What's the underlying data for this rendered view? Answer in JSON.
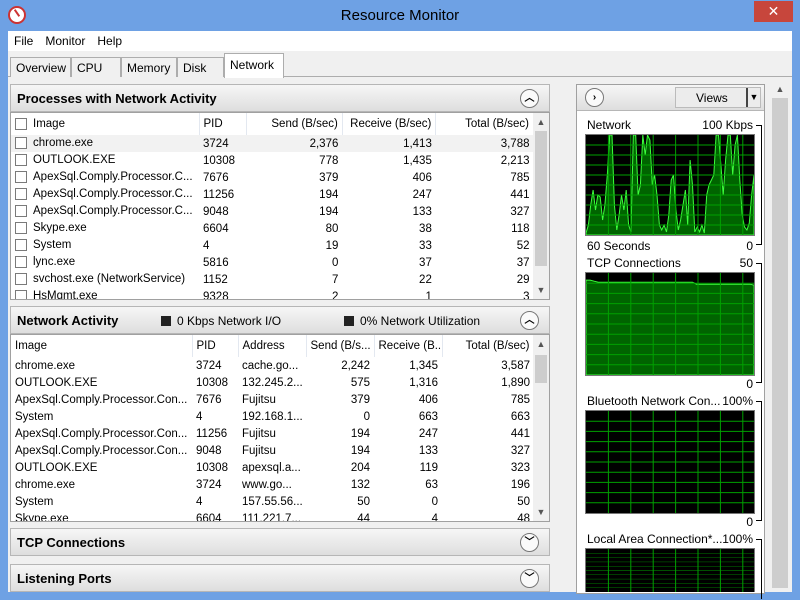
{
  "window": {
    "title": "Resource Monitor",
    "close": "✕"
  },
  "menu": [
    "File",
    "Monitor",
    "Help"
  ],
  "tabs": [
    "Overview",
    "CPU",
    "Memory",
    "Disk",
    "Network"
  ],
  "processes": {
    "title": "Processes with Network Activity",
    "columns": [
      "Image",
      "PID",
      "Send (B/sec)",
      "Receive (B/sec)",
      "Total (B/sec)"
    ],
    "rows": [
      [
        "chrome.exe",
        "3724",
        "2,376",
        "1,413",
        "3,788"
      ],
      [
        "OUTLOOK.EXE",
        "10308",
        "778",
        "1,435",
        "2,213"
      ],
      [
        "ApexSql.Comply.Processor.C...",
        "7676",
        "379",
        "406",
        "785"
      ],
      [
        "ApexSql.Comply.Processor.C...",
        "11256",
        "194",
        "247",
        "441"
      ],
      [
        "ApexSql.Comply.Processor.C...",
        "9048",
        "194",
        "133",
        "327"
      ],
      [
        "Skype.exe",
        "6604",
        "80",
        "38",
        "118"
      ],
      [
        "System",
        "4",
        "19",
        "33",
        "52"
      ],
      [
        "lync.exe",
        "5816",
        "0",
        "37",
        "37"
      ],
      [
        "svchost.exe (NetworkService)",
        "1152",
        "7",
        "22",
        "29"
      ],
      [
        "HsMgmt.exe",
        "9328",
        "2",
        "1",
        "3"
      ]
    ]
  },
  "activity": {
    "title": "Network Activity",
    "legend1": "0 Kbps Network I/O",
    "legend2": "0% Network Utilization",
    "columns": [
      "Image",
      "PID",
      "Address",
      "Send (B/s...",
      "Receive (B...",
      "Total (B/sec)"
    ],
    "rows": [
      [
        "chrome.exe",
        "3724",
        "cache.go...",
        "2,242",
        "1,345",
        "3,587"
      ],
      [
        "OUTLOOK.EXE",
        "10308",
        "132.245.2...",
        "575",
        "1,316",
        "1,890"
      ],
      [
        "ApexSql.Comply.Processor.Con...",
        "7676",
        "Fujitsu",
        "379",
        "406",
        "785"
      ],
      [
        "System",
        "4",
        "192.168.1...",
        "0",
        "663",
        "663"
      ],
      [
        "ApexSql.Comply.Processor.Con...",
        "11256",
        "Fujitsu",
        "194",
        "247",
        "441"
      ],
      [
        "ApexSql.Comply.Processor.Con...",
        "9048",
        "Fujitsu",
        "194",
        "133",
        "327"
      ],
      [
        "OUTLOOK.EXE",
        "10308",
        "apexsql.a...",
        "204",
        "119",
        "323"
      ],
      [
        "chrome.exe",
        "3724",
        "www.go...",
        "132",
        "63",
        "196"
      ],
      [
        "System",
        "4",
        "157.55.56...",
        "50",
        "0",
        "50"
      ],
      [
        "Skype.exe",
        "6604",
        "111.221.7...",
        "44",
        "4",
        "48"
      ]
    ]
  },
  "tcp": {
    "title": "TCP Connections"
  },
  "listening": {
    "title": "Listening Ports"
  },
  "right": {
    "views": "Views",
    "network": {
      "label": "Network",
      "max": "100 Kbps",
      "time": "60 Seconds",
      "min": "0",
      "values": [
        2,
        10,
        30,
        45,
        25,
        40,
        38,
        15,
        30,
        60,
        100,
        100,
        30,
        5,
        20,
        40,
        25,
        45,
        10,
        3,
        100,
        100,
        40,
        50,
        100,
        80,
        100,
        95,
        50,
        60,
        40,
        10,
        5,
        10,
        3,
        20,
        55,
        60,
        25,
        5,
        15,
        30,
        45,
        10,
        75,
        50,
        3,
        8,
        3,
        10,
        2,
        40,
        50,
        55,
        60,
        100,
        100,
        70,
        40,
        75,
        100,
        100,
        60,
        90,
        100,
        55,
        20,
        8,
        5,
        12,
        40,
        60
      ]
    },
    "tcp": {
      "label": "TCP Connections",
      "max": "50",
      "min": "0",
      "values": [
        93,
        93,
        92,
        91,
        91,
        91,
        91,
        91,
        91,
        91,
        91,
        91,
        91,
        91,
        91,
        91,
        91,
        91,
        91,
        91,
        91,
        91,
        91,
        91,
        91,
        91,
        91,
        89,
        89,
        89,
        89,
        89,
        89,
        89,
        89,
        89,
        89,
        89,
        89,
        89,
        89,
        88
      ]
    },
    "bluetooth": {
      "label": "Bluetooth Network Con...",
      "max": "100%",
      "min": "0"
    },
    "lan": {
      "label": "Local Area Connection*...",
      "max": "100%"
    }
  }
}
